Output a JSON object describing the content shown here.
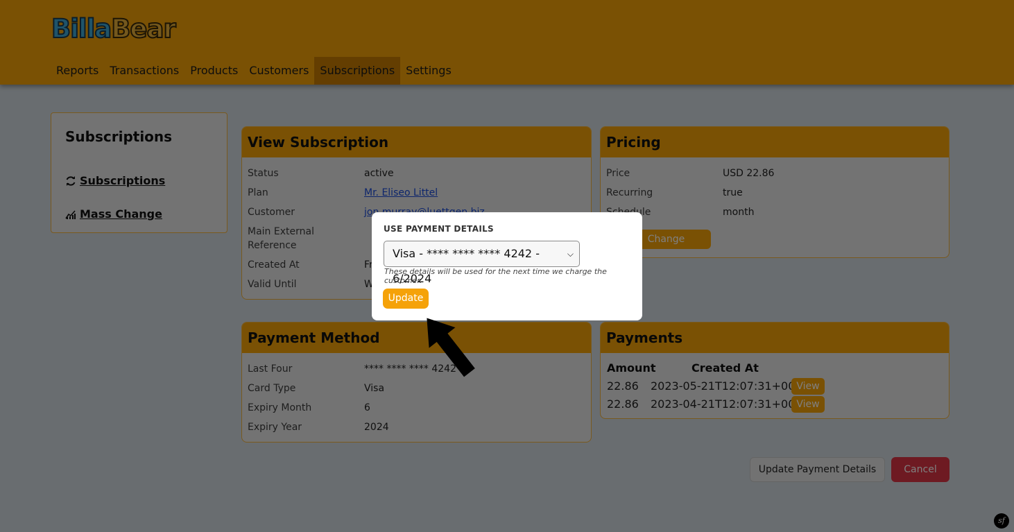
{
  "header": {
    "logo": {
      "part1": "Billa",
      "part2": "Bear"
    },
    "nav": [
      {
        "label": "Reports"
      },
      {
        "label": "Transactions"
      },
      {
        "label": "Products"
      },
      {
        "label": "Customers"
      },
      {
        "label": "Subscriptions",
        "active": true
      },
      {
        "label": "Settings"
      }
    ]
  },
  "sidebar": {
    "title": "Subscriptions",
    "items": [
      {
        "label": "Subscriptions",
        "icon": "refresh-icon"
      },
      {
        "label": "Mass Change",
        "icon": "chart-icon"
      }
    ]
  },
  "view_subscription": {
    "title": "View Subscription",
    "rows": [
      {
        "key": "Status",
        "value": "active"
      },
      {
        "key": "Plan",
        "value": "Mr. Eliseo Littel"
      },
      {
        "key": "Customer",
        "value": "jon.murray@luettgen.biz"
      },
      {
        "key": "Main External Reference",
        "value": ""
      },
      {
        "key": "Created At",
        "value": "Fr"
      },
      {
        "key": "Valid Until",
        "value": "W"
      }
    ]
  },
  "pricing": {
    "title": "Pricing",
    "rows": [
      {
        "key": "Price",
        "value": "USD 22.86"
      },
      {
        "key": "Recurring",
        "value": "true"
      },
      {
        "key": "Schedule",
        "value": "month"
      }
    ],
    "change_label": "Change"
  },
  "payment_method": {
    "title": "Payment Method",
    "rows": [
      {
        "key": "Last Four",
        "value": "**** **** **** 4242"
      },
      {
        "key": "Card Type",
        "value": "Visa"
      },
      {
        "key": "Expiry Month",
        "value": "6"
      },
      {
        "key": "Expiry Year",
        "value": "2024"
      }
    ]
  },
  "payments": {
    "title": "Payments",
    "headers": {
      "amount": "Amount",
      "created_at": "Created At"
    },
    "items": [
      {
        "amount": "22.86",
        "created_at": "2023-05-21T12:07:31+00:00",
        "action": "View"
      },
      {
        "amount": "22.86",
        "created_at": "2023-04-21T12:07:31+00:00",
        "action": "View"
      }
    ]
  },
  "actions": {
    "update_payment": "Update Payment Details",
    "cancel": "Cancel"
  },
  "modal": {
    "title": "USE PAYMENT DETAILS",
    "selected_option": "Visa - **** **** **** 4242 - 6/2024",
    "hint": "These details will be used for the next time we charge the customer.",
    "update_label": "Update"
  },
  "footer": {
    "badge": "sf"
  },
  "colors": {
    "accent": "#f5a209",
    "accent_dark": "#c97c02",
    "danger": "#dc3545",
    "link": "#1a4bd8",
    "page_bg": "#d3dbe0"
  }
}
